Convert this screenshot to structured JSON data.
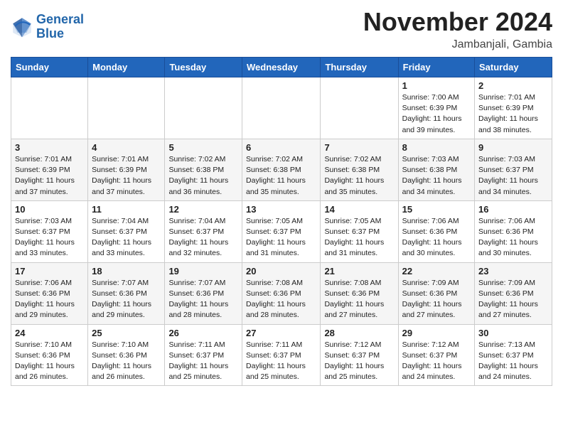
{
  "header": {
    "logo_line1": "General",
    "logo_line2": "Blue",
    "month": "November 2024",
    "location": "Jambanjali, Gambia"
  },
  "weekdays": [
    "Sunday",
    "Monday",
    "Tuesday",
    "Wednesday",
    "Thursday",
    "Friday",
    "Saturday"
  ],
  "weeks": [
    [
      {
        "day": "",
        "info": ""
      },
      {
        "day": "",
        "info": ""
      },
      {
        "day": "",
        "info": ""
      },
      {
        "day": "",
        "info": ""
      },
      {
        "day": "",
        "info": ""
      },
      {
        "day": "1",
        "info": "Sunrise: 7:00 AM\nSunset: 6:39 PM\nDaylight: 11 hours\nand 39 minutes."
      },
      {
        "day": "2",
        "info": "Sunrise: 7:01 AM\nSunset: 6:39 PM\nDaylight: 11 hours\nand 38 minutes."
      }
    ],
    [
      {
        "day": "3",
        "info": "Sunrise: 7:01 AM\nSunset: 6:39 PM\nDaylight: 11 hours\nand 37 minutes."
      },
      {
        "day": "4",
        "info": "Sunrise: 7:01 AM\nSunset: 6:39 PM\nDaylight: 11 hours\nand 37 minutes."
      },
      {
        "day": "5",
        "info": "Sunrise: 7:02 AM\nSunset: 6:38 PM\nDaylight: 11 hours\nand 36 minutes."
      },
      {
        "day": "6",
        "info": "Sunrise: 7:02 AM\nSunset: 6:38 PM\nDaylight: 11 hours\nand 35 minutes."
      },
      {
        "day": "7",
        "info": "Sunrise: 7:02 AM\nSunset: 6:38 PM\nDaylight: 11 hours\nand 35 minutes."
      },
      {
        "day": "8",
        "info": "Sunrise: 7:03 AM\nSunset: 6:38 PM\nDaylight: 11 hours\nand 34 minutes."
      },
      {
        "day": "9",
        "info": "Sunrise: 7:03 AM\nSunset: 6:37 PM\nDaylight: 11 hours\nand 34 minutes."
      }
    ],
    [
      {
        "day": "10",
        "info": "Sunrise: 7:03 AM\nSunset: 6:37 PM\nDaylight: 11 hours\nand 33 minutes."
      },
      {
        "day": "11",
        "info": "Sunrise: 7:04 AM\nSunset: 6:37 PM\nDaylight: 11 hours\nand 33 minutes."
      },
      {
        "day": "12",
        "info": "Sunrise: 7:04 AM\nSunset: 6:37 PM\nDaylight: 11 hours\nand 32 minutes."
      },
      {
        "day": "13",
        "info": "Sunrise: 7:05 AM\nSunset: 6:37 PM\nDaylight: 11 hours\nand 31 minutes."
      },
      {
        "day": "14",
        "info": "Sunrise: 7:05 AM\nSunset: 6:37 PM\nDaylight: 11 hours\nand 31 minutes."
      },
      {
        "day": "15",
        "info": "Sunrise: 7:06 AM\nSunset: 6:36 PM\nDaylight: 11 hours\nand 30 minutes."
      },
      {
        "day": "16",
        "info": "Sunrise: 7:06 AM\nSunset: 6:36 PM\nDaylight: 11 hours\nand 30 minutes."
      }
    ],
    [
      {
        "day": "17",
        "info": "Sunrise: 7:06 AM\nSunset: 6:36 PM\nDaylight: 11 hours\nand 29 minutes."
      },
      {
        "day": "18",
        "info": "Sunrise: 7:07 AM\nSunset: 6:36 PM\nDaylight: 11 hours\nand 29 minutes."
      },
      {
        "day": "19",
        "info": "Sunrise: 7:07 AM\nSunset: 6:36 PM\nDaylight: 11 hours\nand 28 minutes."
      },
      {
        "day": "20",
        "info": "Sunrise: 7:08 AM\nSunset: 6:36 PM\nDaylight: 11 hours\nand 28 minutes."
      },
      {
        "day": "21",
        "info": "Sunrise: 7:08 AM\nSunset: 6:36 PM\nDaylight: 11 hours\nand 27 minutes."
      },
      {
        "day": "22",
        "info": "Sunrise: 7:09 AM\nSunset: 6:36 PM\nDaylight: 11 hours\nand 27 minutes."
      },
      {
        "day": "23",
        "info": "Sunrise: 7:09 AM\nSunset: 6:36 PM\nDaylight: 11 hours\nand 27 minutes."
      }
    ],
    [
      {
        "day": "24",
        "info": "Sunrise: 7:10 AM\nSunset: 6:36 PM\nDaylight: 11 hours\nand 26 minutes."
      },
      {
        "day": "25",
        "info": "Sunrise: 7:10 AM\nSunset: 6:36 PM\nDaylight: 11 hours\nand 26 minutes."
      },
      {
        "day": "26",
        "info": "Sunrise: 7:11 AM\nSunset: 6:37 PM\nDaylight: 11 hours\nand 25 minutes."
      },
      {
        "day": "27",
        "info": "Sunrise: 7:11 AM\nSunset: 6:37 PM\nDaylight: 11 hours\nand 25 minutes."
      },
      {
        "day": "28",
        "info": "Sunrise: 7:12 AM\nSunset: 6:37 PM\nDaylight: 11 hours\nand 25 minutes."
      },
      {
        "day": "29",
        "info": "Sunrise: 7:12 AM\nSunset: 6:37 PM\nDaylight: 11 hours\nand 24 minutes."
      },
      {
        "day": "30",
        "info": "Sunrise: 7:13 AM\nSunset: 6:37 PM\nDaylight: 11 hours\nand 24 minutes."
      }
    ]
  ]
}
